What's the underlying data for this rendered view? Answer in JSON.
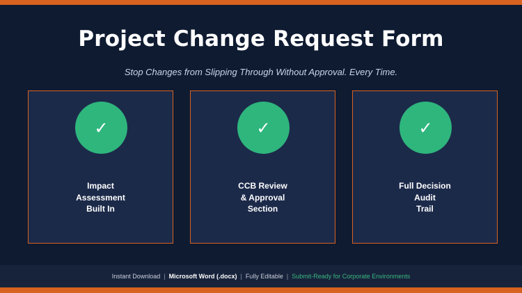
{
  "header": {
    "title": "Project Change Request Form",
    "subtitle": "Stop Changes from Slipping Through Without Approval. Every Time."
  },
  "cards": [
    {
      "icon": "check-icon",
      "check_glyph": "✓",
      "lines": [
        "Impact",
        "Assessment",
        "Built In"
      ]
    },
    {
      "icon": "check-icon",
      "check_glyph": "✓",
      "lines": [
        "CCB Review",
        "& Approval",
        "Section"
      ]
    },
    {
      "icon": "check-icon",
      "check_glyph": "✓",
      "lines": [
        "Full Decision",
        "Audit",
        "Trail"
      ]
    }
  ],
  "footer": {
    "item1": "Instant Download",
    "item2": "Microsoft Word (.docx)",
    "item3": "Fully Editable",
    "item4": "Submit-Ready for Corporate Environments",
    "separator": "|"
  },
  "colors": {
    "background": "#0f1b31",
    "accent": "#d8621f",
    "card": "#1c2a4a",
    "check": "#2eb67d",
    "footer_highlight": "#39b77f"
  }
}
